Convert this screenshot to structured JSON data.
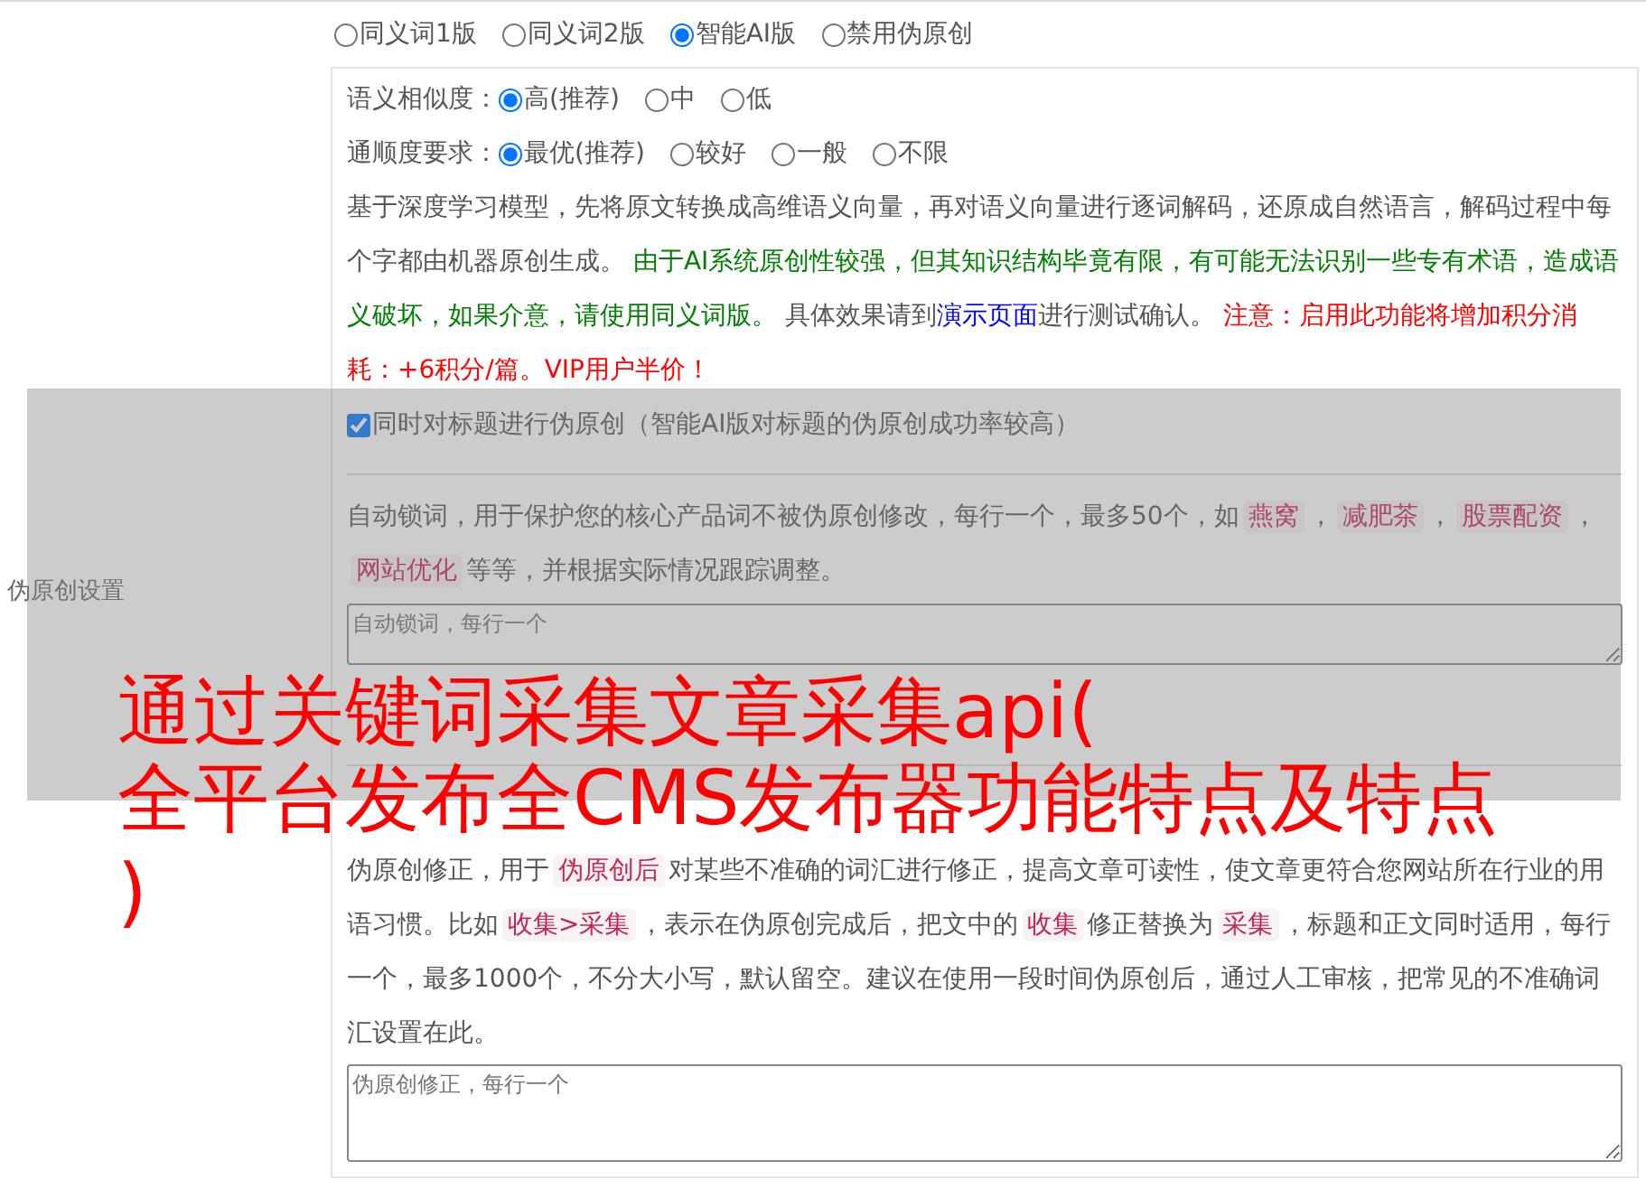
{
  "mode_options": [
    {
      "label": "同义词1版",
      "selected": false
    },
    {
      "label": "同义词2版",
      "selected": false
    },
    {
      "label": "智能AI版",
      "selected": true
    },
    {
      "label": "禁用伪原创",
      "selected": false
    }
  ],
  "settings_label": "伪原创设置",
  "similarity": {
    "label": "语义相似度：",
    "options": [
      {
        "label": "高(推荐)",
        "selected": true
      },
      {
        "label": "中",
        "selected": false
      },
      {
        "label": "低",
        "selected": false
      }
    ]
  },
  "fluency": {
    "label": "通顺度要求：",
    "options": [
      {
        "label": "最优(推荐)",
        "selected": true
      },
      {
        "label": "较好",
        "selected": false
      },
      {
        "label": "一般",
        "selected": false
      },
      {
        "label": "不限",
        "selected": false
      }
    ]
  },
  "description": [
    {
      "kind": "plain",
      "text": "基于深度学习模型，先将原文转换成高维语义向量，再对语义向量进行逐词解码，还原成自然语言，解码过程中每个字都由机器原创生成。 "
    },
    {
      "kind": "caution",
      "text": "由于AI系统原创性较强，但其知识结构毕竟有限，有可能无法识别一些专有术语，造成语义破坏，如果介意，请使用同义词版。"
    },
    {
      "kind": "plain",
      "text": " 具体效果请到"
    },
    {
      "kind": "link",
      "text": "演示页面"
    },
    {
      "kind": "plain",
      "text": "进行测试确认。 "
    },
    {
      "kind": "notice",
      "text": "注意：启用此功能将增加积分消耗：+6积分/篇。VIP用户半价！"
    }
  ],
  "title_option": {
    "label": "同时对标题进行伪原创（智能AI版对标题的伪原创成功率较高）",
    "checked": true
  },
  "lock_words": {
    "segments": [
      {
        "kind": "plain",
        "text": "自动锁词，用于保护您的核心产品词不被伪原创修改，每行一个，最多50个，如"
      },
      {
        "kind": "tag",
        "text": "燕窝"
      },
      {
        "kind": "plain",
        "text": "，"
      },
      {
        "kind": "tag",
        "text": "减肥茶"
      },
      {
        "kind": "plain",
        "text": "，"
      },
      {
        "kind": "tag",
        "text": "股票配资"
      },
      {
        "kind": "plain",
        "text": "，"
      },
      {
        "kind": "tag",
        "text": "网站优化"
      },
      {
        "kind": "plain",
        "text": "等等，并根据实际情况跟踪调整。"
      }
    ],
    "placeholder": "自动锁词，每行一个"
  },
  "corrections": {
    "segments": [
      {
        "kind": "plain",
        "text": "伪原创修正，用于"
      },
      {
        "kind": "tag",
        "text": "伪原创后"
      },
      {
        "kind": "plain",
        "text": "对某些不准确的词汇进行修正，提高文章可读性，使文章更符合您网站所在行业的用语习惯。比如"
      },
      {
        "kind": "tag",
        "text": "收集>采集"
      },
      {
        "kind": "plain",
        "text": "，表示在伪原创完成后，把文中的"
      },
      {
        "kind": "tag",
        "text": "收集"
      },
      {
        "kind": "plain",
        "text": "修正替换为"
      },
      {
        "kind": "tag",
        "text": "采集"
      },
      {
        "kind": "plain",
        "text": "，标题和正文同时适用，每行一个，最多1000个，不分大小写，默认留空。建议在使用一段时间伪原创后，通过人工审核，把常见的不准确词汇设置在此。"
      }
    ],
    "placeholder": "伪原创修正，每行一个"
  },
  "overlay_title": [
    "通过关键词采集文章采集api(",
    "全平台发布全CMS发布器功能特点及特点",
    ")"
  ]
}
